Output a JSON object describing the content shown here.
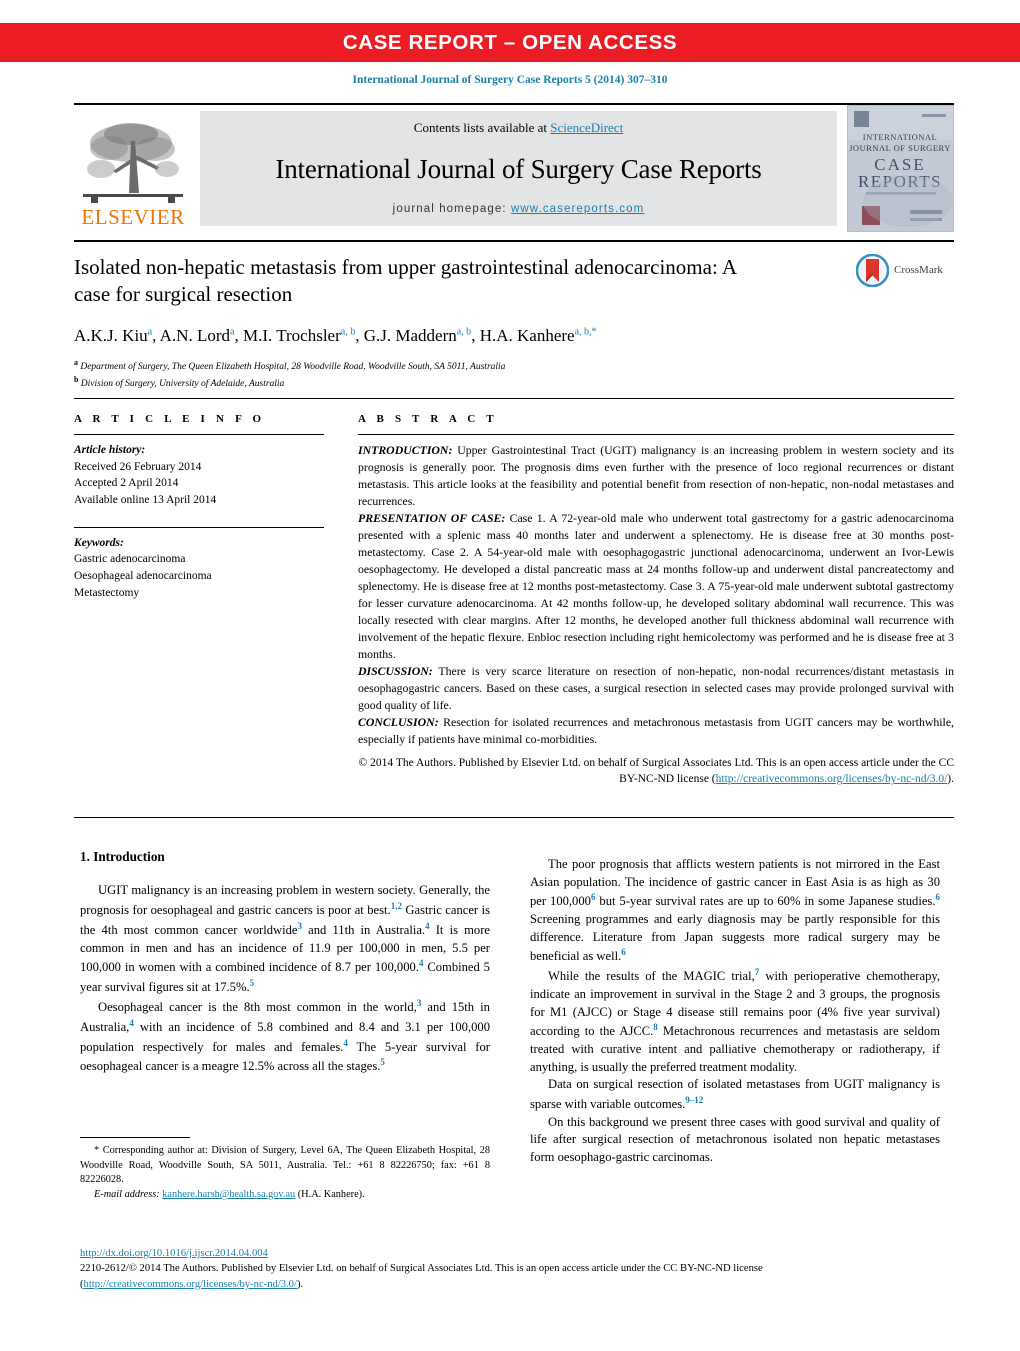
{
  "banner": {
    "label": "CASE REPORT – OPEN ACCESS",
    "color": "#ec1c24"
  },
  "journal_ref": "International Journal of Surgery Case Reports 5 (2014) 307–310",
  "masthead": {
    "publisher_wordmark": "ELSEVIER",
    "contents_prefix": "Contents lists available at ",
    "contents_link": "ScienceDirect",
    "journal_title": "International Journal of Surgery Case Reports",
    "homepage_prefix": "journal homepage: ",
    "homepage_url": "www.casereports.com",
    "cover_lines": [
      "INTERNATIONAL",
      "JOURNAL OF SURGERY",
      "CASE",
      "REPORTS"
    ]
  },
  "article": {
    "title": "Isolated non-hepatic metastasis from upper gastrointestinal adenocarcinoma: A case for surgical resection",
    "authors_html": "A.K.J. Kiu<sup>a</sup>, A.N. Lord<sup>a</sup>, M.I. Trochsler<sup>a, b</sup>, G.J. Maddern<sup>a, b</sup>, H.A. Kanhere<sup>a, b,*</sup>",
    "affiliation_a": "Department of Surgery, The Queen Elizabeth Hospital, 28 Woodville Road, Woodville South, SA 5011, Australia",
    "affiliation_b": "Division of Surgery, University of Adelaide, Australia",
    "crossmark_label": "CrossMark"
  },
  "article_info": {
    "heading": "A R T I C L E  I N F O",
    "history_label": "Article history:",
    "history": [
      "Received 26 February 2014",
      "Accepted 2 April 2014",
      "Available online 13 April 2014"
    ],
    "keywords_label": "Keywords:",
    "keywords": [
      "Gastric adenocarcinoma",
      "Oesophageal adenocarcinoma",
      "Metastectomy"
    ]
  },
  "abstract": {
    "heading": "A B S T R A C T",
    "sections": [
      {
        "label": "INTRODUCTION:",
        "text": " Upper Gastrointestinal Tract (UGIT) malignancy is an increasing problem in western society and its prognosis is generally poor. The prognosis dims even further with the presence of loco regional recurrences or distant metastasis. This article looks at the feasibility and potential benefit from resection of non-hepatic, non-nodal metastases and recurrences."
      },
      {
        "label": "PRESENTATION OF CASE:",
        "text": " Case 1. A 72-year-old male who underwent total gastrectomy for a gastric adenocarcinoma presented with a splenic mass 40 months later and underwent a splenectomy. He is disease free at 30 months post-metastectomy. Case 2. A 54-year-old male with oesophagogastric junctional adenocarcinoma, underwent an Ivor-Lewis oesophagectomy. He developed a distal pancreatic mass at 24 months follow-up and underwent distal pancreatectomy and splenectomy. He is disease free at 12 months post-metastectomy. Case 3. A 75-year-old male underwent subtotal gastrectomy for lesser curvature adenocarcinoma. At 42 months follow-up, he developed solitary abdominal wall recurrence. This was locally resected with clear margins. After 12 months, he developed another full thickness abdominal wall recurrence with involvement of the hepatic flexure. Enbloc resection including right hemicolectomy was performed and he is disease free at 3 months."
      },
      {
        "label": "DISCUSSION:",
        "text": " There is very scarce literature on resection of non-hepatic, non-nodal recurrences/distant metastasis in oesophagogastric cancers. Based on these cases, a surgical resection in selected cases may provide prolonged survival with good quality of life."
      },
      {
        "label": "CONCLUSION:",
        "text": " Resection for isolated recurrences and metachronous metastasis from UGIT cancers may be worthwhile, especially if patients have minimal co-morbidities."
      }
    ],
    "copyright_text": "© 2014 The Authors. Published by Elsevier Ltd. on behalf of Surgical Associates Ltd. This is an open access article under the CC BY-NC-ND license (",
    "copyright_link": "http://creativecommons.org/licenses/by-nc-nd/3.0/",
    "copyright_tail": ")."
  },
  "intro": {
    "heading": "1.  Introduction",
    "left_paragraphs": [
      "UGIT malignancy is an increasing problem in western society. Generally, the prognosis for oesophageal and gastric cancers is poor at best.<sup>1,2</sup> Gastric cancer is the 4th most common cancer worldwide<sup>3</sup> and 11th in Australia.<sup>4</sup> It is more common in men and has an incidence of 11.9 per 100,000 in men, 5.5 per 100,000 in women with a combined incidence of 8.7 per 100,000.<sup>4</sup> Combined 5 year survival figures sit at 17.5%.<sup>5</sup>",
      "Oesophageal cancer is the 8th most common in the world,<sup>3</sup> and 15th in Australia,<sup>4</sup> with an incidence of 5.8 combined and 8.4 and 3.1 per 100,000 population respectively for males and females.<sup>4</sup> The 5-year survival for oesophageal cancer is a meagre 12.5% across all the stages.<sup>5</sup>"
    ],
    "right_paragraphs": [
      "The poor prognosis that afflicts western patients is not mirrored in the East Asian population. The incidence of gastric cancer in East Asia is as high as 30 per 100,000<sup>6</sup> but 5-year survival rates are up to 60% in some Japanese studies.<sup>6</sup> Screening programmes and early diagnosis may be partly responsible for this difference. Literature from Japan suggests more radical surgery may be beneficial as well.<sup>6</sup>",
      "While the results of the MAGIC trial,<sup>7</sup> with perioperative chemotherapy, indicate an improvement in survival in the Stage 2 and 3 groups, the prognosis for M1 (AJCC) or Stage 4 disease still remains poor (4% five year survival) according to the AJCC.<sup>8</sup> Metachronous recurrences and metastasis are seldom treated with curative intent and palliative chemotherapy or radiotherapy, if anything, is usually the preferred treatment modality.",
      "Data on surgical resection of isolated metastases from UGIT malignancy is sparse with variable outcomes.<sup>9–12</sup>",
      "On this background we present three cases with good survival and quality of life after surgical resection of metachronous isolated non hepatic metastases form oesophago-gastric carcinomas."
    ]
  },
  "footnotes": {
    "corresponding": "* Corresponding author at: Division of Surgery, Level 6A, The Queen Elizabeth Hospital, 28 Woodville Road, Woodville South, SA 5011, Australia. Tel.: +61 8 82226750; fax: +61 8 82226028.",
    "email_label": "E-mail address:",
    "email": "kanhere.harsh@health.sa.gov.au",
    "email_owner": "(H.A. Kanhere)."
  },
  "bottom": {
    "doi": "http://dx.doi.org/10.1016/j.ijscr.2014.04.004",
    "issn_line": "2210-2612/© 2014 The Authors. Published by Elsevier Ltd. on behalf of Surgical Associates Ltd. This is an open access article under the CC BY-NC-ND license",
    "license_open": "(",
    "license_link": "http://creativecommons.org/licenses/by-nc-nd/3.0/",
    "license_close": ")."
  }
}
